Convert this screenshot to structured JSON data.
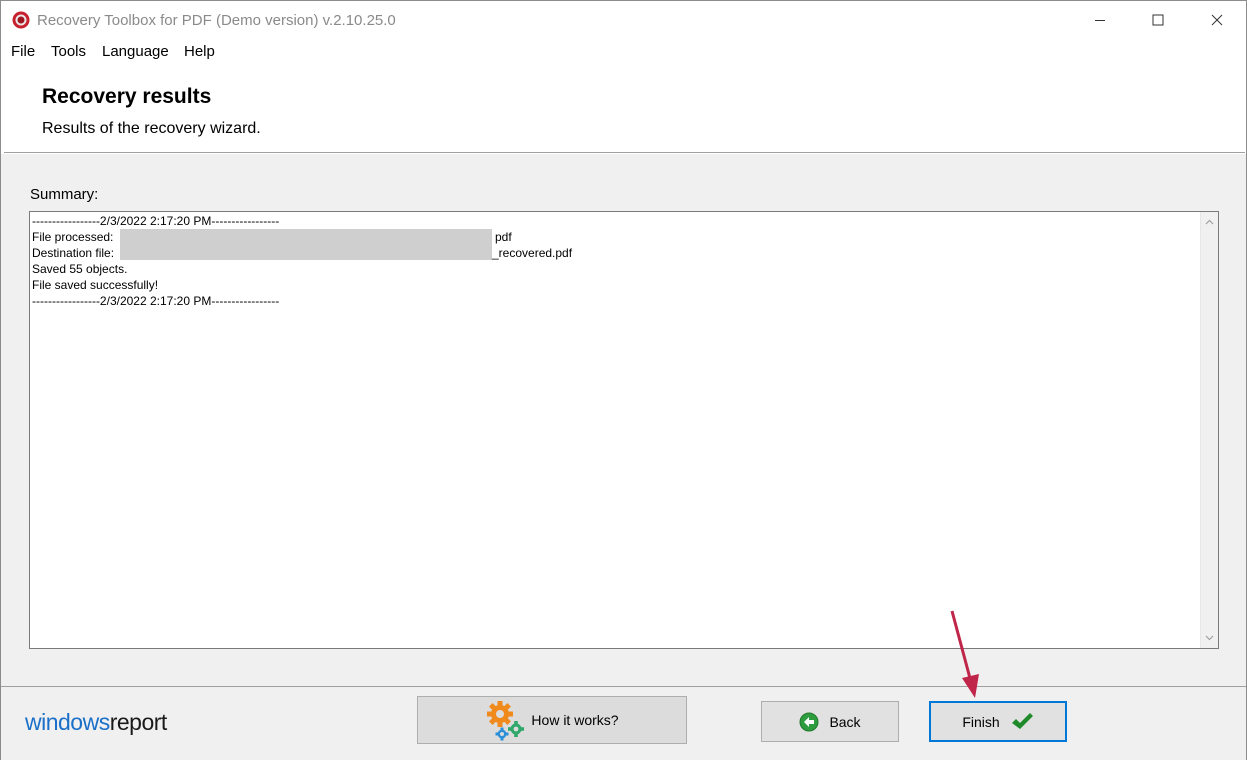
{
  "window": {
    "title": "Recovery Toolbox for PDF (Demo version) v.2.10.25.0"
  },
  "menu": {
    "items": [
      "File",
      "Tools",
      "Language",
      "Help"
    ]
  },
  "header": {
    "title": "Recovery results",
    "subtitle": "Results of the recovery wizard."
  },
  "summary": {
    "label": "Summary:",
    "lines": [
      "-----------------2/3/2022 2:17:20 PM-----------------",
      "File processed:",
      "pdf",
      "Destination file:",
      "_recovered.pdf",
      "Saved 55 objects.",
      "File saved successfully!",
      "-----------------2/3/2022 2:17:20 PM-----------------"
    ]
  },
  "footer": {
    "logo_part1": "windows",
    "logo_part2": "report",
    "how_it_works_label": "How it works?",
    "back_label": "Back",
    "finish_label": "Finish"
  },
  "colors": {
    "accent": "#0078d7",
    "annotation_arrow": "#c0254a",
    "logo_blue": "#1a6fc9"
  }
}
